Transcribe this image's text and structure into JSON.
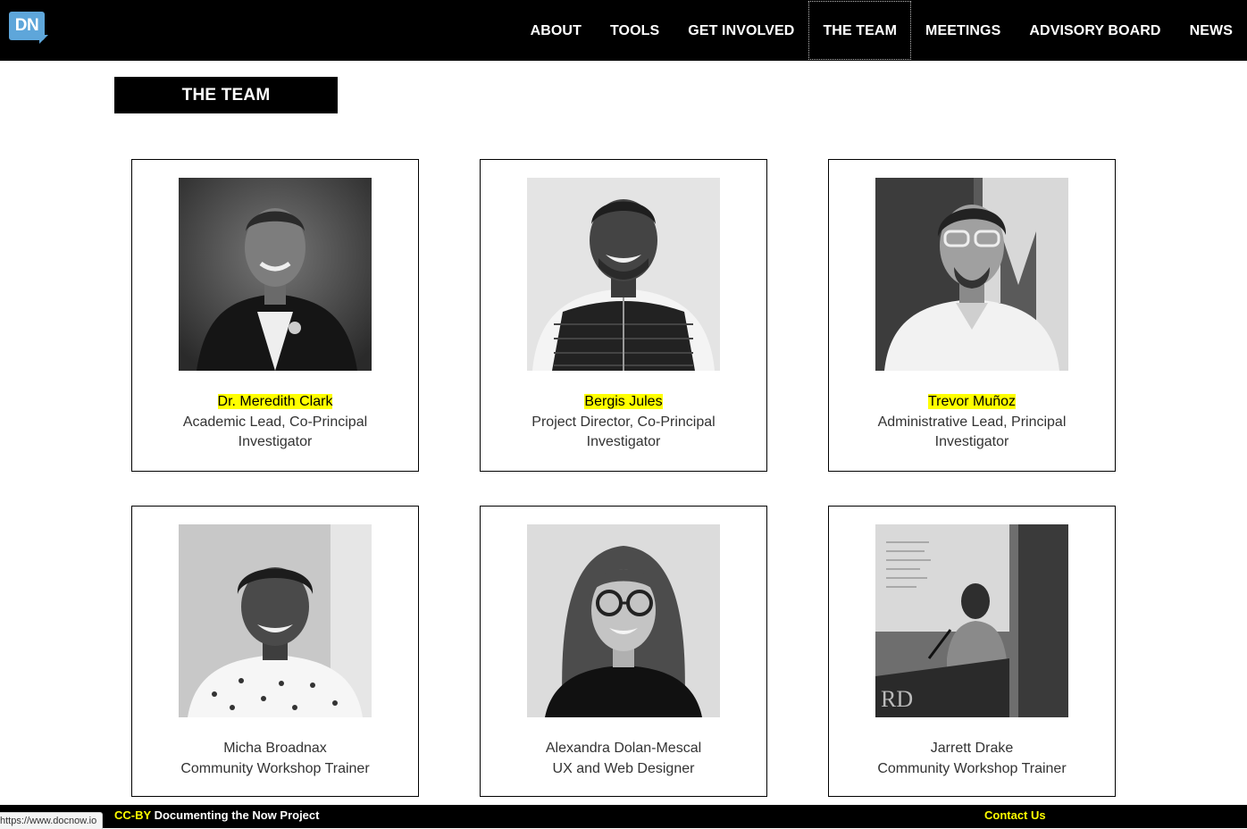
{
  "logo": {
    "text": "DN"
  },
  "nav": {
    "items": [
      {
        "label": "ABOUT"
      },
      {
        "label": "TOOLS"
      },
      {
        "label": "GET INVOLVED"
      },
      {
        "label": "THE TEAM",
        "active": true
      },
      {
        "label": "MEETINGS"
      },
      {
        "label": "ADVISORY BOARD"
      },
      {
        "label": "NEWS"
      }
    ]
  },
  "page": {
    "title": "THE TEAM"
  },
  "team": [
    {
      "name": "Dr. Meredith Clark",
      "role": "Academic Lead, Co-Principal Investigator",
      "highlighted": true
    },
    {
      "name": "Bergis Jules",
      "role": "Project Director, Co-Principal Investigator",
      "highlighted": true
    },
    {
      "name": "Trevor Muñoz",
      "role": "Administrative Lead, Principal Investigator",
      "highlighted": true
    },
    {
      "name": "Micha Broadnax",
      "role": "Community Workshop Trainer",
      "highlighted": false
    },
    {
      "name": "Alexandra Dolan-Mescal",
      "role": "UX and Web Designer",
      "highlighted": false
    },
    {
      "name": "Jarrett Drake",
      "role": "Community Workshop Trainer",
      "highlighted": false
    }
  ],
  "footer": {
    "status_url": "https://www.docnow.io",
    "license": "CC-BY",
    "project": "Documenting the Now Project",
    "contact": "Contact Us"
  },
  "colors": {
    "highlight": "#ffff00",
    "logo_blue": "#5ea6da",
    "nav_bg": "#000000"
  }
}
